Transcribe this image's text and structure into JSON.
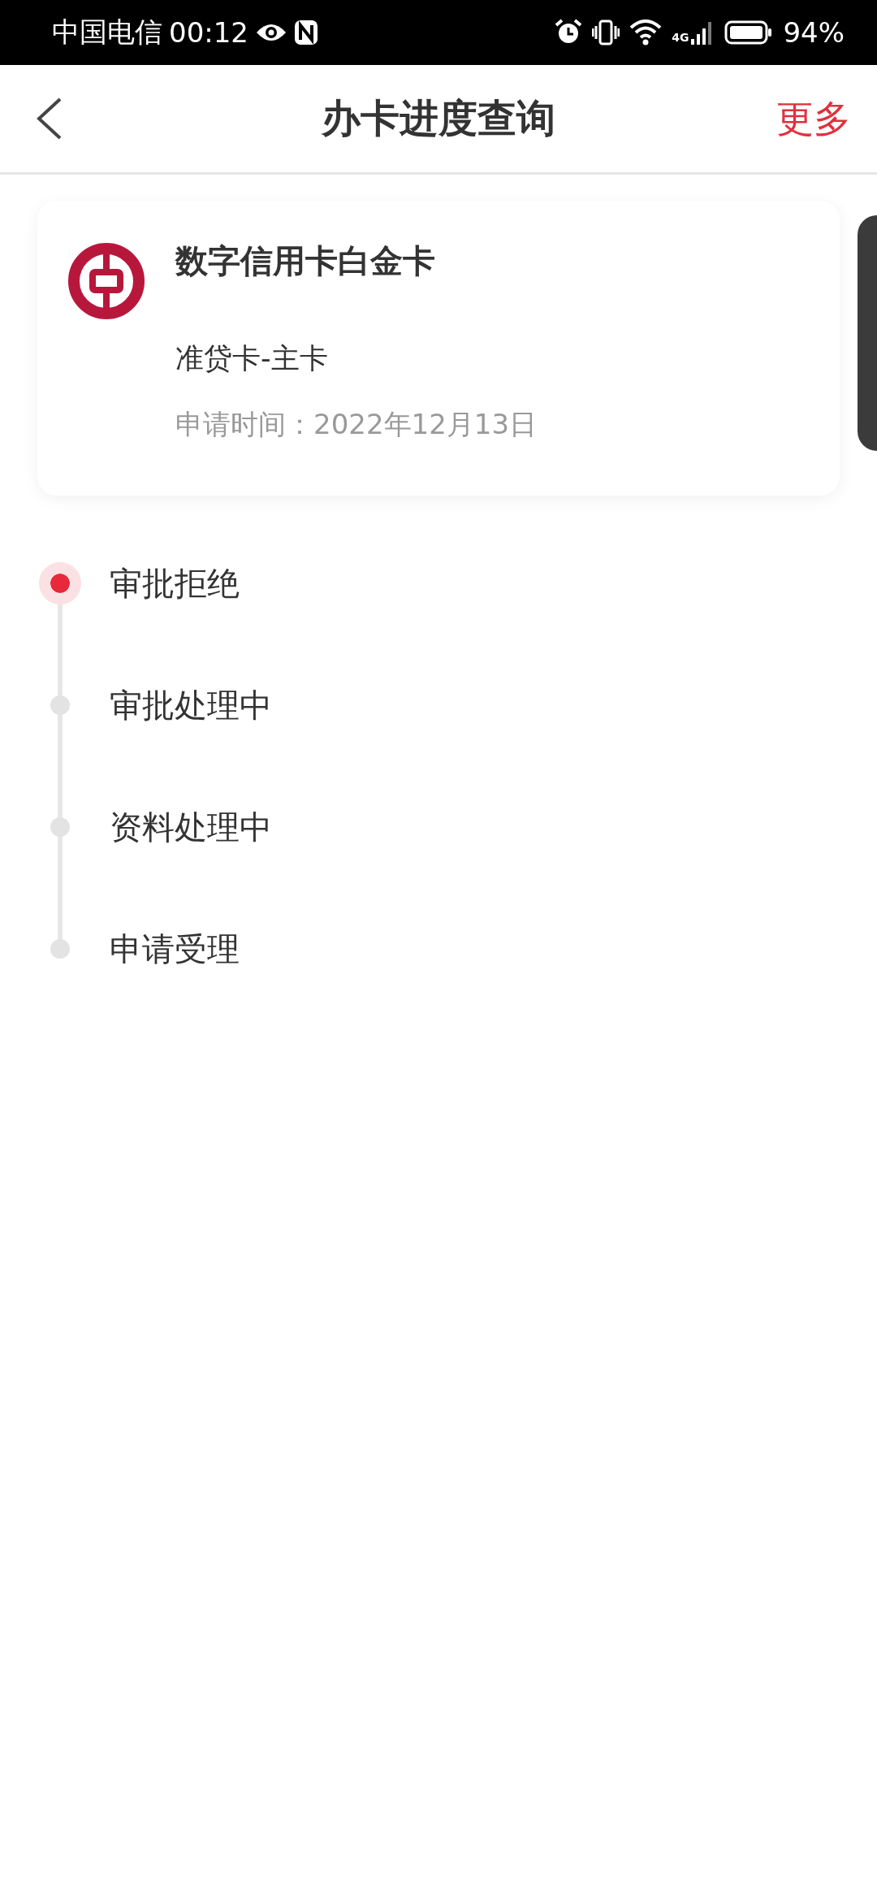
{
  "status_bar": {
    "carrier": "中国电信",
    "time": "00:12",
    "network": "4G",
    "battery": "94%"
  },
  "header": {
    "title": "办卡进度查询",
    "action": "更多"
  },
  "card": {
    "name": "数字信用卡白金卡",
    "type": "准贷卡-主卡",
    "date_label": "申请时间：",
    "date": "2022年12月13日"
  },
  "timeline": [
    {
      "label": "审批拒绝",
      "current": true
    },
    {
      "label": "审批处理中",
      "current": false
    },
    {
      "label": "资料处理中",
      "current": false
    },
    {
      "label": "申请受理",
      "current": false
    }
  ]
}
